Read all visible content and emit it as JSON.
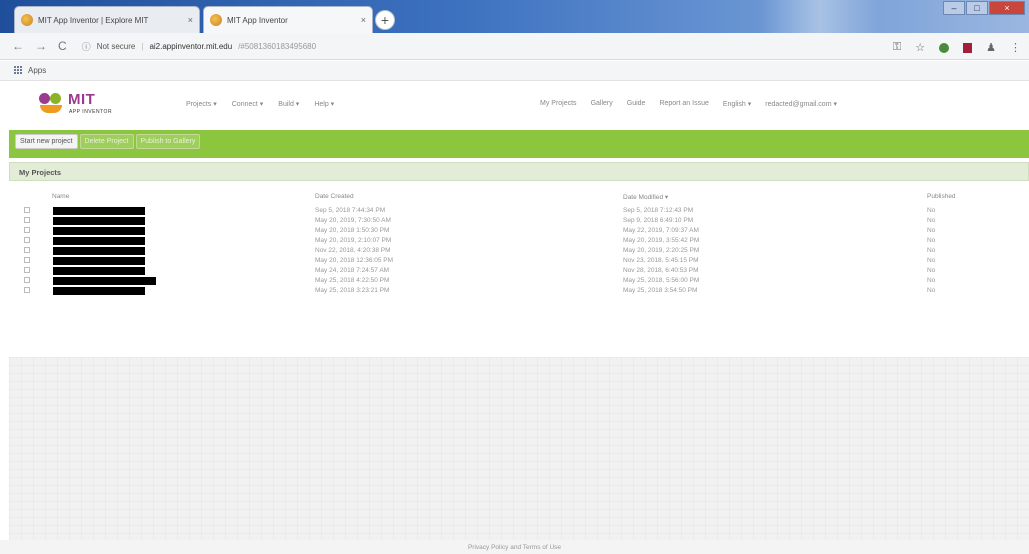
{
  "browser": {
    "tabs": [
      {
        "title": "MIT App Inventor | Explore MIT",
        "close": "×"
      },
      {
        "title": "MIT App Inventor",
        "close": "×"
      }
    ],
    "new_tab": "+",
    "window": {
      "minimize": "–",
      "maximize": "□",
      "close": "×"
    },
    "nav": {
      "back": "←",
      "forward": "→",
      "reload": "C"
    },
    "url": {
      "security": "Not secure",
      "domain": "ai2.appinventor.mit.edu",
      "path": "/#5081360183495680"
    },
    "bookmarks": {
      "apps_label": "Apps"
    }
  },
  "app": {
    "logo": {
      "brand": "MIT",
      "sub": "APP INVENTOR"
    },
    "menu_left": [
      "Projects ▾",
      "Connect ▾",
      "Build ▾",
      "Help ▾"
    ],
    "menu_right": [
      "My Projects",
      "Gallery",
      "Guide",
      "Report an Issue",
      "English ▾",
      "redacted@gmail.com ▾"
    ]
  },
  "toolbar": {
    "start_new": "Start new project",
    "delete": "Delete Project",
    "publish": "Publish to Gallery"
  },
  "projects": {
    "title": "My Projects",
    "columns": {
      "name": "Name",
      "created": "Date Created",
      "modified": "Date Modified ▾",
      "published": "Published"
    },
    "rows": [
      {
        "created": "Sep 5, 2018 7:44:34 PM",
        "modified": "Sep 5, 2018 7:12:43 PM",
        "published": "No"
      },
      {
        "created": "May 20, 2019, 7:30:50 AM",
        "modified": "Sep 9, 2018 6:49:10 PM",
        "published": "No"
      },
      {
        "created": "May 20, 2018 1:50:30 PM",
        "modified": "May 22, 2019, 7:09:37 AM",
        "published": "No"
      },
      {
        "created": "May 20, 2019, 2:10:07 PM",
        "modified": "May 20, 2019, 3:55:42 PM",
        "published": "No"
      },
      {
        "created": "Nov 22, 2018, 4:20:38 PM",
        "modified": "May 20, 2019, 2:20:25 PM",
        "published": "No"
      },
      {
        "created": "May 20, 2018 12:36:05 PM",
        "modified": "Nov 23, 2018, 5:45:15 PM",
        "published": "No"
      },
      {
        "created": "May 24, 2018 7:24:57 AM",
        "modified": "Nov 28, 2018, 6:40:53 PM",
        "published": "No"
      },
      {
        "created": "May 25, 2018 4:22:50 PM",
        "modified": "May 25, 2018, 5:56:00 PM",
        "published": "No"
      },
      {
        "created": "May 25, 2018 3:23:21 PM",
        "modified": "May 25, 2018 3:54:50 PM",
        "published": "No"
      }
    ]
  },
  "footer": {
    "text": "Privacy Policy and Terms of Use"
  }
}
